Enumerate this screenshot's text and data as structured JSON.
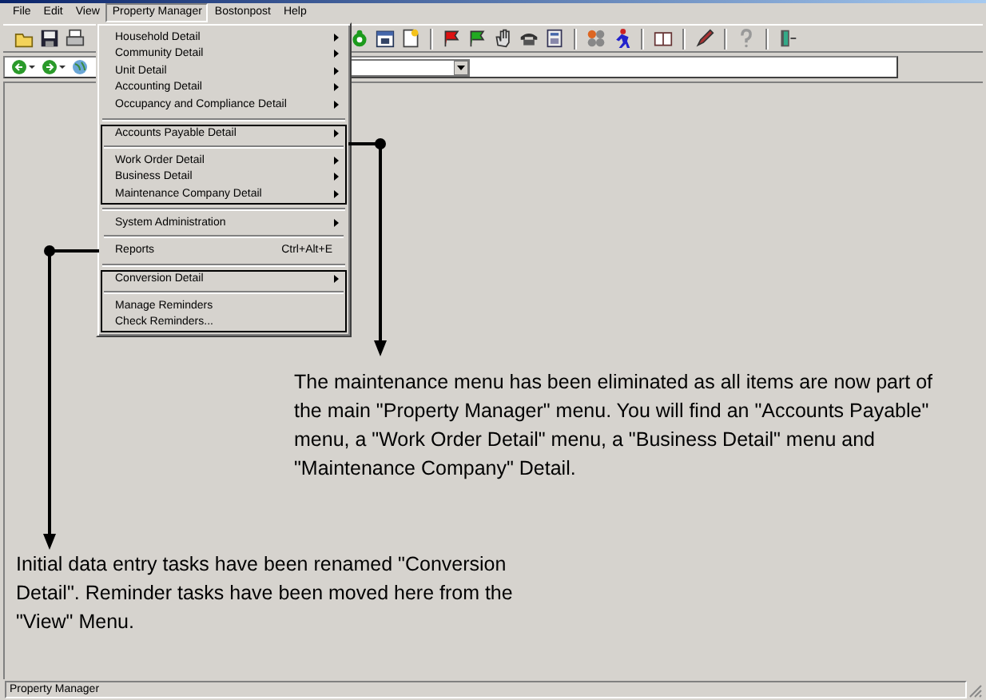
{
  "menubar": [
    {
      "label": "File",
      "selected": false
    },
    {
      "label": "Edit",
      "selected": false
    },
    {
      "label": "View",
      "selected": false
    },
    {
      "label": "Property Manager",
      "selected": true
    },
    {
      "label": "Bostonpost",
      "selected": false
    },
    {
      "label": "Help",
      "selected": false
    }
  ],
  "menu": {
    "sections": [
      {
        "highlighted": false,
        "groups": [
          [
            {
              "label": "Household Detail",
              "submenu": true
            },
            {
              "label": "Community Detail",
              "submenu": true
            },
            {
              "label": "Unit Detail",
              "submenu": true
            },
            {
              "label": "Accounting Detail",
              "submenu": true
            },
            {
              "label": "Occupancy and Compliance Detail",
              "submenu": true
            }
          ]
        ]
      },
      {
        "highlighted": true,
        "groups": [
          [
            {
              "label": "Accounts Payable Detail",
              "submenu": true
            }
          ],
          [
            {
              "label": "Work Order Detail",
              "submenu": true
            },
            {
              "label": "Business Detail",
              "submenu": true
            },
            {
              "label": "Maintenance Company Detail",
              "submenu": true
            }
          ]
        ]
      },
      {
        "highlighted": false,
        "groups": [
          [
            {
              "label": "System Administration",
              "submenu": true
            }
          ],
          [
            {
              "label": "Reports",
              "submenu": false,
              "shortcut": "Ctrl+Alt+E"
            }
          ]
        ]
      },
      {
        "highlighted": true,
        "groups": [
          [
            {
              "label": "Conversion Detail",
              "submenu": true
            }
          ],
          [
            {
              "label": "Manage Reminders",
              "submenu": false
            },
            {
              "label": "Check Reminders...",
              "submenu": false
            }
          ]
        ]
      }
    ]
  },
  "annotations": [
    {
      "text": "The maintenance menu has been eliminated as all items are now part of the main \"Property Manager\" menu.  You will find an \"Accounts Payable\" menu, a \"Work Order Detail\" menu, a \"Business Detail\" menu and \"Maintenance Company\" Detail."
    },
    {
      "text": "Initial data entry tasks have been renamed \"Conversion Detail\".  Reminder tasks have been moved here from the \"View\" Menu."
    }
  ],
  "status_bar": "Property Manager"
}
